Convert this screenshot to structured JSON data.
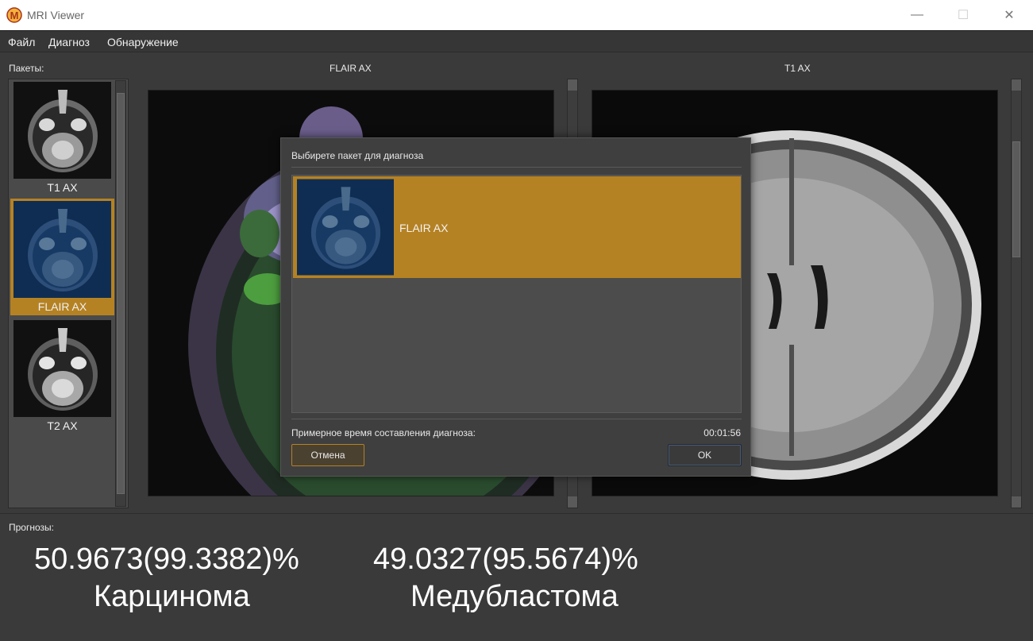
{
  "window": {
    "title": "MRI Viewer",
    "icon": "mri-logo-icon",
    "controls": {
      "minimize": "—",
      "maximize": "☐",
      "close": "✕"
    }
  },
  "menu": [
    "Файл",
    "Диагноз",
    "Обнаружение"
  ],
  "packets": {
    "label": "Пакеты:",
    "items": [
      {
        "label": "T1 AX",
        "selected": false
      },
      {
        "label": "FLAIR AX",
        "selected": true
      },
      {
        "label": "T2 AX",
        "selected": false
      }
    ]
  },
  "viewers": {
    "left_title": "FLAIR AX",
    "right_title": "T1 AX"
  },
  "dialog": {
    "title": "Выбирете пакет для диагноза",
    "selected_item": "FLAIR AX",
    "estimate_label": "Примерное время составления диагноза:",
    "estimate_time": "00:01:56",
    "cancel": "Отмена",
    "ok": "OK"
  },
  "predictions": {
    "label": "Прогнозы:",
    "items": [
      {
        "value": "50.9673(99.3382)%",
        "name": "Карцинома"
      },
      {
        "value": "49.0327(95.5674)%",
        "name": "Медубластома"
      }
    ]
  },
  "colors": {
    "accent": "#b58223",
    "background": "#3a3a3a",
    "viewer_bg": "#0d0d0d"
  }
}
